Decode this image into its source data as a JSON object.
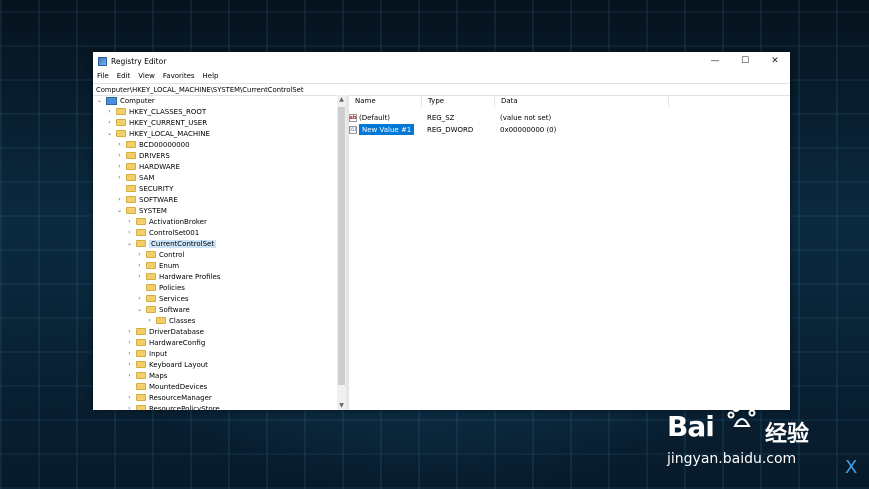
{
  "window": {
    "title": "Registry Editor",
    "min_glyph": "—",
    "max_glyph": "☐",
    "close_glyph": "✕"
  },
  "menu": [
    "File",
    "Edit",
    "View",
    "Favorites",
    "Help"
  ],
  "address": "Computer\\HKEY_LOCAL_MACHINE\\SYSTEM\\CurrentControlSet",
  "tree": {
    "root": "Computer",
    "items": [
      {
        "label": "HKEY_CLASSES_ROOT",
        "depth": 1,
        "chev": "›"
      },
      {
        "label": "HKEY_CURRENT_USER",
        "depth": 1,
        "chev": "›"
      },
      {
        "label": "HKEY_LOCAL_MACHINE",
        "depth": 1,
        "chev": "⌄"
      },
      {
        "label": "BCD00000000",
        "depth": 2,
        "chev": "›"
      },
      {
        "label": "DRIVERS",
        "depth": 2,
        "chev": "›"
      },
      {
        "label": "HARDWARE",
        "depth": 2,
        "chev": "›"
      },
      {
        "label": "SAM",
        "depth": 2,
        "chev": "›"
      },
      {
        "label": "SECURITY",
        "depth": 2,
        "chev": ""
      },
      {
        "label": "SOFTWARE",
        "depth": 2,
        "chev": "›"
      },
      {
        "label": "SYSTEM",
        "depth": 2,
        "chev": "⌄"
      },
      {
        "label": "ActivationBroker",
        "depth": 3,
        "chev": "›"
      },
      {
        "label": "ControlSet001",
        "depth": 3,
        "chev": "›"
      },
      {
        "label": "CurrentControlSet",
        "depth": 3,
        "chev": "⌄",
        "selected": true
      },
      {
        "label": "Control",
        "depth": 4,
        "chev": "›"
      },
      {
        "label": "Enum",
        "depth": 4,
        "chev": "›"
      },
      {
        "label": "Hardware Profiles",
        "depth": 4,
        "chev": "›"
      },
      {
        "label": "Policies",
        "depth": 4,
        "chev": ""
      },
      {
        "label": "Services",
        "depth": 4,
        "chev": "›"
      },
      {
        "label": "Software",
        "depth": 4,
        "chev": "⌄"
      },
      {
        "label": "Classes",
        "depth": 5,
        "chev": "›"
      },
      {
        "label": "DriverDatabase",
        "depth": 3,
        "chev": "›"
      },
      {
        "label": "HardwareConfig",
        "depth": 3,
        "chev": "›"
      },
      {
        "label": "Input",
        "depth": 3,
        "chev": "›"
      },
      {
        "label": "Keyboard Layout",
        "depth": 3,
        "chev": "›"
      },
      {
        "label": "Maps",
        "depth": 3,
        "chev": "›"
      },
      {
        "label": "MountedDevices",
        "depth": 3,
        "chev": ""
      },
      {
        "label": "ResourceManager",
        "depth": 3,
        "chev": "›"
      },
      {
        "label": "ResourcePolicyStore",
        "depth": 3,
        "chev": "›"
      }
    ]
  },
  "columns": {
    "name": "Name",
    "type": "Type",
    "data": "Data"
  },
  "values": [
    {
      "name": "(Default)",
      "type": "REG_SZ",
      "data": "(value not set)",
      "icon": "ab",
      "editing": false
    },
    {
      "name": "New Value #1",
      "type": "REG_DWORD",
      "data": "0x00000000 (0)",
      "icon": "011",
      "editing": true
    }
  ],
  "watermark": {
    "logo": "Bai",
    "logo_suffix": "经验",
    "url": "jingyan.baidu.com"
  }
}
